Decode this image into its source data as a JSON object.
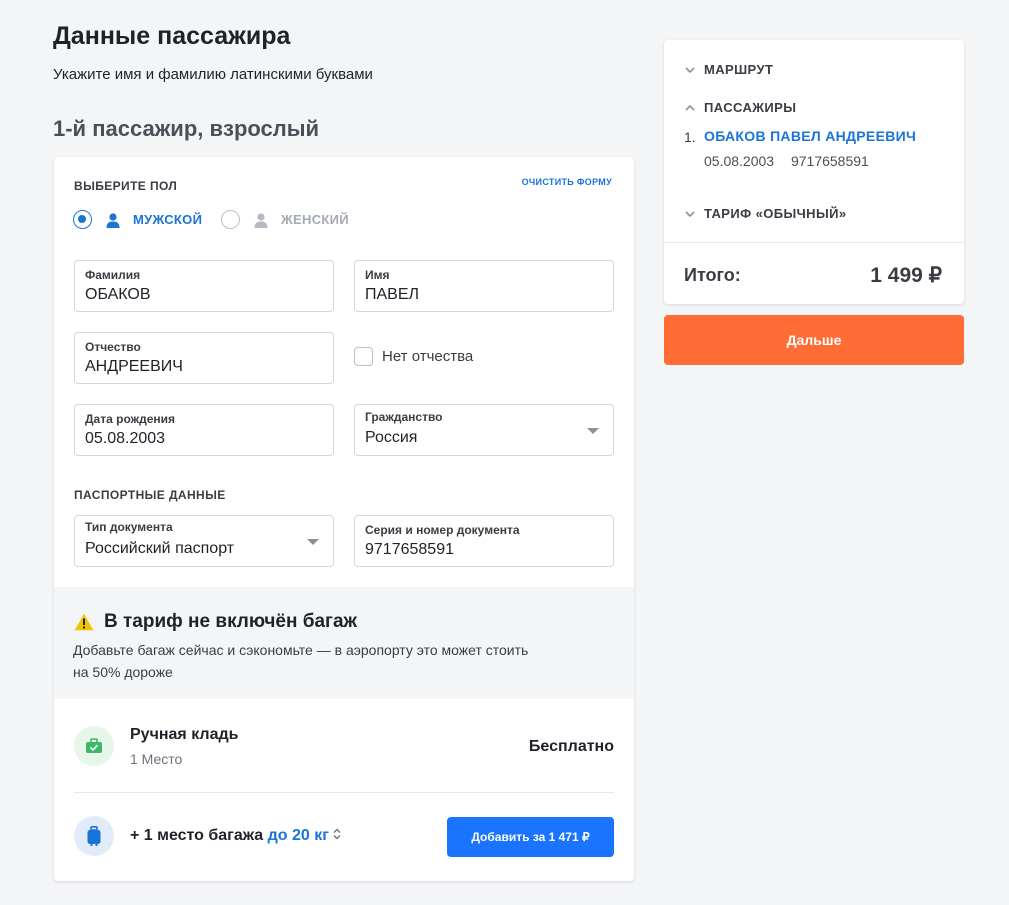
{
  "header": {
    "title": "Данные пассажира",
    "subtitle": "Укажите имя и фамилию латинскими буквами",
    "passenger_heading": "1-й пассажир, взрослый"
  },
  "form": {
    "gender_label": "ВЫБЕРИТЕ ПОЛ",
    "clear_form": "ОЧИСТИТЬ ФОРМУ",
    "gender": {
      "male": "МУЖСКОЙ",
      "female": "ЖЕНСКИЙ",
      "selected": "male"
    },
    "surname": {
      "label": "Фамилия",
      "value": "ОБАКОВ"
    },
    "name": {
      "label": "Имя",
      "value": "ПАВЕЛ"
    },
    "patronymic": {
      "label": "Отчество",
      "value": "АНДРЕЕВИЧ"
    },
    "no_patronymic": {
      "label": "Нет отчества",
      "checked": false
    },
    "birth_date": {
      "label": "Дата рождения",
      "value": "05.08.2003"
    },
    "citizenship": {
      "label": "Гражданство",
      "value": "Россия"
    },
    "passport_label": "ПАСПОРТНЫЕ ДАННЫЕ",
    "doc_type": {
      "label": "Тип документа",
      "value": "Российский паспорт"
    },
    "doc_number": {
      "label": "Серия и номер документа",
      "value": "9717658591"
    }
  },
  "baggage": {
    "warning_title": "В тариф не включён багаж",
    "warning_line1": "Добавьте багаж сейчас и сэкономьте — в аэропорту это может стоить",
    "warning_line2": "на 50% дороже",
    "carry_on": {
      "name": "Ручная кладь",
      "sub": "1 Место",
      "price": "Бесплатно"
    },
    "extra": {
      "prefix": "+ 1 место багажа",
      "weight": "до 20 кг",
      "button": "Добавить за 1 471 ₽"
    }
  },
  "summary": {
    "route": "МАРШРУТ",
    "passengers": "ПАССАЖИРЫ",
    "pax_index": "1.",
    "pax_name": "ОБАКОВ ПАВЕЛ АНДРЕЕВИЧ",
    "pax_birth": "05.08.2003",
    "pax_doc": "9717658591",
    "tariff": "ТАРИФ «ОБЫЧНЫЙ»",
    "total_label": "Итого:",
    "total_value": "1 499 ₽",
    "next_button": "Дальше"
  },
  "colors": {
    "accent": "#1a74d8",
    "primary_button": "#1a74ff",
    "next_button": "#ff6d34"
  }
}
